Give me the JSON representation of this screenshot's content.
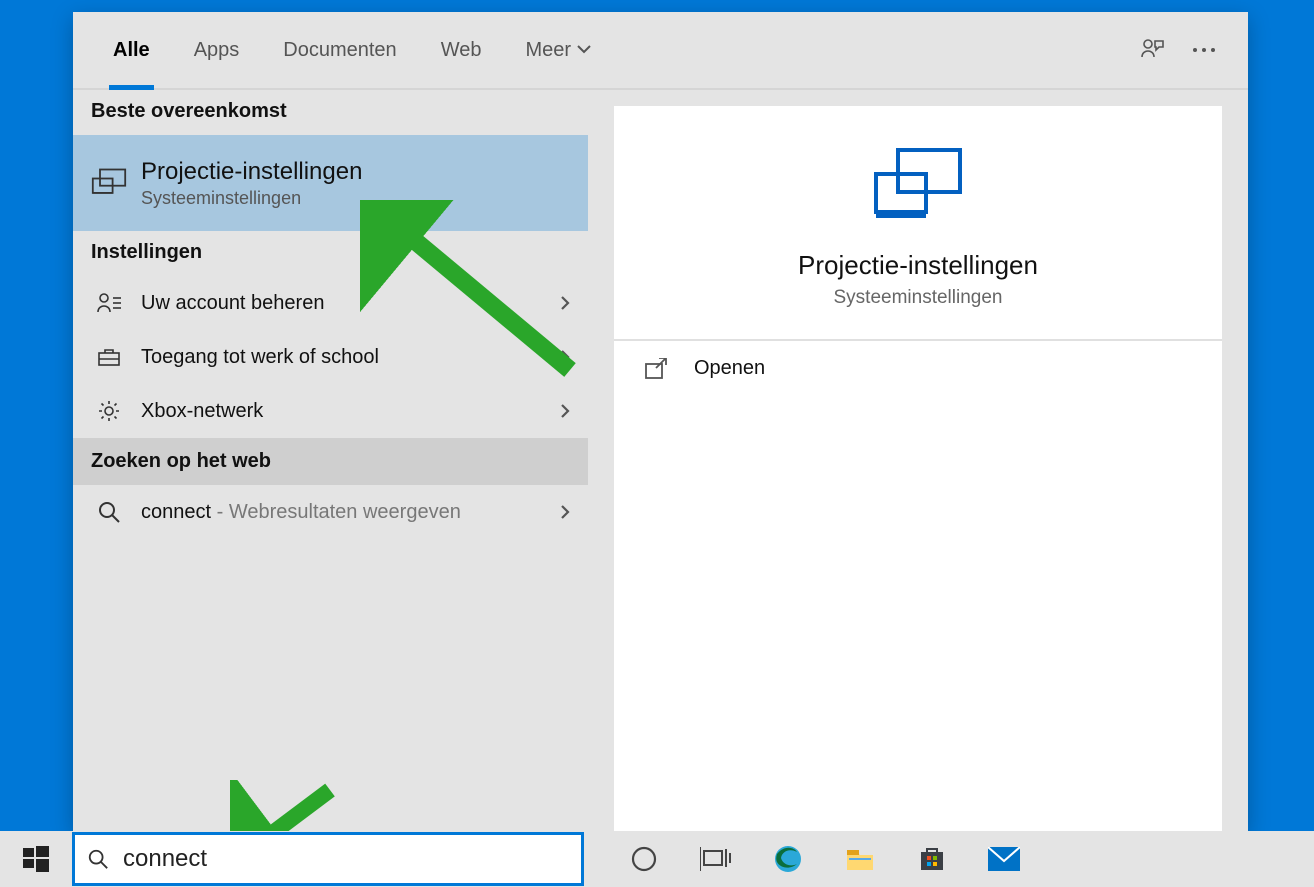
{
  "tabs": {
    "all": "Alle",
    "apps": "Apps",
    "documents": "Documenten",
    "web": "Web",
    "more": "Meer"
  },
  "sections": {
    "best": "Beste overeenkomst",
    "settings": "Instellingen",
    "websearch": "Zoeken op het web"
  },
  "results": {
    "best": {
      "title": "Projectie-instellingen",
      "subtitle": "Systeeminstellingen"
    },
    "settings": [
      {
        "title": "Uw account beheren"
      },
      {
        "title": "Toegang tot werk of school"
      },
      {
        "title": "Xbox-netwerk"
      }
    ],
    "web": {
      "term": "connect",
      "suffix": " - Webresultaten weergeven"
    }
  },
  "preview": {
    "title": "Projectie-instellingen",
    "subtitle": "Systeeminstellingen",
    "action": "Openen"
  },
  "search": {
    "value": "connect"
  }
}
